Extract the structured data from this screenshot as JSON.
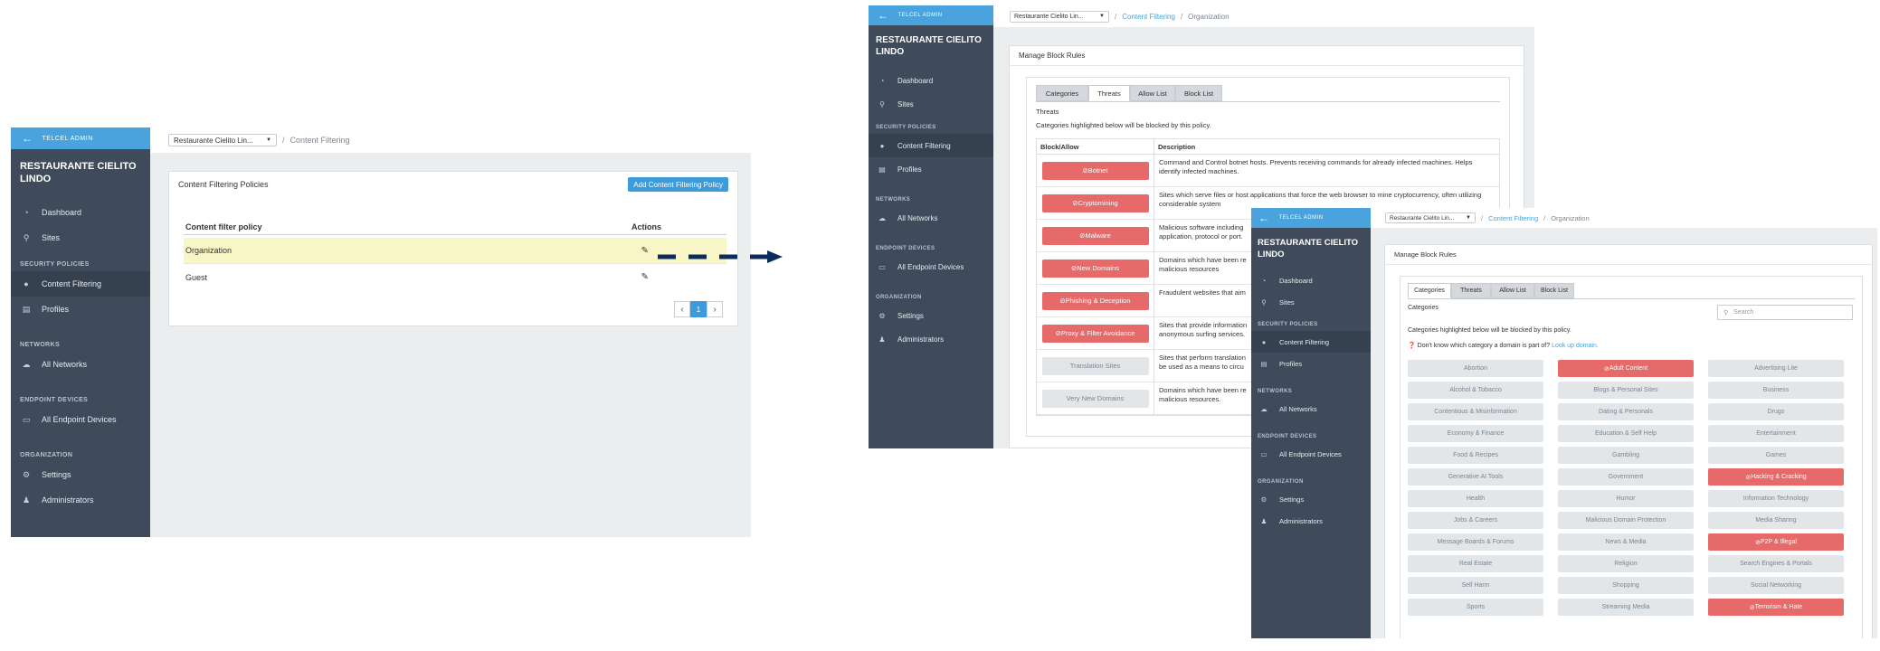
{
  "brand": {
    "accent": "#4aa3dc",
    "sidebar_bg": "#3f4b5b",
    "block": "#e76a6a",
    "allow": "#e3e6e9"
  },
  "sidebar": {
    "back_label": "TELCEL ADMIN",
    "org_name": "RESTAURANTE CIELITO LINDO",
    "items": {
      "dashboard": {
        "label": "Dashboard",
        "icon": "dashboard-icon"
      },
      "sites": {
        "label": "Sites",
        "icon": "map-pin-icon"
      },
      "content_filtering": {
        "label": "Content Filtering",
        "icon": "user-icon"
      },
      "profiles": {
        "label": "Profiles",
        "icon": "document-icon"
      },
      "all_networks": {
        "label": "All Networks",
        "icon": "cloud-icon"
      },
      "all_endpoint_devices": {
        "label": "All Endpoint Devices",
        "icon": "laptop-icon"
      },
      "settings": {
        "label": "Settings",
        "icon": "gear-icon"
      },
      "administrators": {
        "label": "Administrators",
        "icon": "admin-user-icon"
      }
    },
    "sections": {
      "security": "SECURITY POLICIES",
      "networks": "NETWORKS",
      "endpoints": "ENDPOINT DEVICES",
      "organization": "ORGANIZATION"
    }
  },
  "shot1": {
    "site_select": "Restaurante Cielito Lin...",
    "breadcrumb": "Content Filtering",
    "panel_title": "Content Filtering Policies",
    "add_button": "Add Content Filtering Policy",
    "col_policy": "Content filter policy",
    "col_actions": "Actions",
    "rows": [
      "Organization",
      "Guest"
    ],
    "pager": {
      "prev": "‹",
      "page": "1",
      "next": "›"
    }
  },
  "shot2": {
    "site_select": "Restaurante Cielito Lin...",
    "breadcrumb_link": "Content Filtering",
    "breadcrumb_current": "Organization",
    "panel_title": "Manage Block Rules",
    "tabs": [
      "Categories",
      "Threats",
      "Allow List",
      "Block List"
    ],
    "section_title": "Threats",
    "section_note": "Categories highlighted below will be blocked by this policy.",
    "col_block_allow": "Block/Allow",
    "col_description": "Description",
    "rows": [
      {
        "label": "Botnet",
        "state": "block",
        "desc": "Command and Control botnet hosts. Prevents receiving commands for already infected machines. Helps identify infected machines."
      },
      {
        "label": "Cryptomining",
        "state": "block",
        "desc": "Sites which serve files or host applications that force the web browser to mine cryptocurrency, often utilizing considerable system"
      },
      {
        "label": "Malware",
        "state": "block",
        "desc": "Malicious software including"
      },
      {
        "label": "New Domains",
        "state": "block",
        "desc": "Domains which have been re"
      },
      {
        "label": "Phishing & Deception",
        "state": "block",
        "desc": "Fraudulent websites that aim"
      },
      {
        "label": "Proxy & Filter Avoidance",
        "state": "block",
        "desc": "Sites that provide information"
      },
      {
        "label": "Translation Sites",
        "state": "allow",
        "desc": "Sites that perform translation"
      },
      {
        "label": "Very New Domains",
        "state": "allow",
        "desc": "Domains which have been re"
      }
    ],
    "desc_tail": {
      "malware": "application, protocol or port.",
      "new_domains": "malicious resources",
      "proxy": "anonymous surfing services.",
      "translation": "be used as a means to circu",
      "very_new": "malicious resources."
    }
  },
  "shot3": {
    "site_select": "Restaurante Cielito Lin...",
    "breadcrumb_link": "Content Filtering",
    "breadcrumb_current": "Organization",
    "panel_title": "Manage Block Rules",
    "tabs": [
      "Categories",
      "Threats",
      "Allow List",
      "Block List"
    ],
    "section_title": "Categories",
    "search_placeholder": "Search",
    "section_note": "Categories highlighted below will be blocked by this policy.",
    "help_text": "Don't know which category a domain is part of?",
    "help_link": "Look up domain.",
    "categories": [
      {
        "label": "Abortion",
        "state": "allow"
      },
      {
        "label": "Adult Content",
        "state": "block"
      },
      {
        "label": "Advertising Lite",
        "state": "allow"
      },
      {
        "label": "Alcohol & Tobacco",
        "state": "allow"
      },
      {
        "label": "Blogs & Personal Sites",
        "state": "allow"
      },
      {
        "label": "Business",
        "state": "allow"
      },
      {
        "label": "Contentious & Misinformation",
        "state": "allow"
      },
      {
        "label": "Dating & Personals",
        "state": "allow"
      },
      {
        "label": "Drugs",
        "state": "allow"
      },
      {
        "label": "Economy & Finance",
        "state": "allow"
      },
      {
        "label": "Education & Self Help",
        "state": "allow"
      },
      {
        "label": "Entertainment",
        "state": "allow"
      },
      {
        "label": "Food & Recipes",
        "state": "allow"
      },
      {
        "label": "Gambling",
        "state": "allow"
      },
      {
        "label": "Games",
        "state": "allow"
      },
      {
        "label": "Generative AI Tools",
        "state": "allow"
      },
      {
        "label": "Government",
        "state": "allow"
      },
      {
        "label": "Hacking & Cracking",
        "state": "block"
      },
      {
        "label": "Health",
        "state": "allow"
      },
      {
        "label": "Humor",
        "state": "allow"
      },
      {
        "label": "Information Technology",
        "state": "allow"
      },
      {
        "label": "Jobs & Careers",
        "state": "allow"
      },
      {
        "label": "Malicious Domain Protection",
        "state": "allow"
      },
      {
        "label": "Media Sharing",
        "state": "allow"
      },
      {
        "label": "Message Boards & Forums",
        "state": "allow"
      },
      {
        "label": "News & Media",
        "state": "allow"
      },
      {
        "label": "P2P & Illegal",
        "state": "block"
      },
      {
        "label": "Real Estate",
        "state": "allow"
      },
      {
        "label": "Religion",
        "state": "allow"
      },
      {
        "label": "Search Engines & Portals",
        "state": "allow"
      },
      {
        "label": "Self Harm",
        "state": "allow"
      },
      {
        "label": "Shopping",
        "state": "allow"
      },
      {
        "label": "Social Networking",
        "state": "allow"
      },
      {
        "label": "Sports",
        "state": "allow"
      },
      {
        "label": "Streaming Media",
        "state": "allow"
      },
      {
        "label": "Terrorism & Hate",
        "state": "block"
      }
    ]
  }
}
